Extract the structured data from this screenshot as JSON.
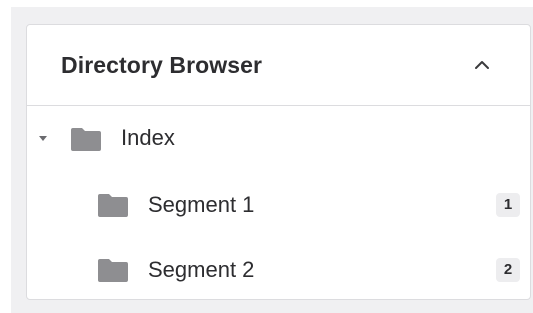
{
  "browser": {
    "title": "Directory Browser",
    "collapse_icon": "chevron-up-icon",
    "folder_icon": "folder-icon",
    "folder_color": "#8e8e91",
    "tree": {
      "root": {
        "label": "Index",
        "expanded": true
      },
      "children": [
        {
          "label": "Segment 1",
          "count": "1"
        },
        {
          "label": "Segment 2",
          "count": "2"
        }
      ]
    }
  }
}
